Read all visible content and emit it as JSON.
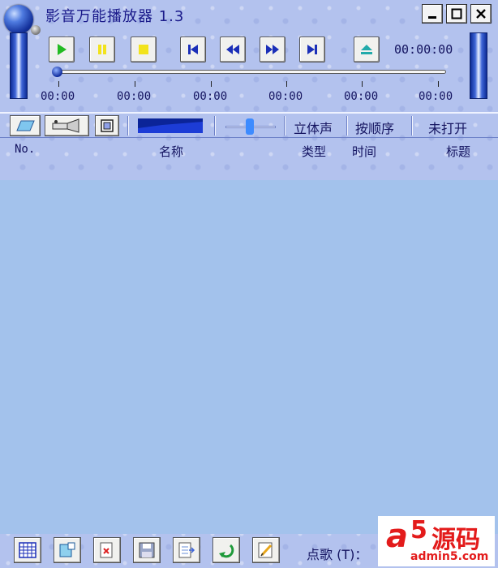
{
  "app": {
    "title": "影音万能播放器 1.3"
  },
  "window_controls": {
    "minimize": "minimize-icon",
    "maximize": "maximize-icon",
    "close": "close-icon"
  },
  "transport": {
    "buttons": [
      "play-icon",
      "pause-icon",
      "stop-icon",
      "previous-track-icon",
      "rewind-icon",
      "fast-forward-icon",
      "next-track-icon",
      "eject-icon"
    ],
    "total_time": "00:00:00"
  },
  "progress": {
    "position_fraction": 0,
    "tick_labels": [
      "00:00",
      "00:00",
      "00:00",
      "00:00",
      "00:00",
      "00:00"
    ]
  },
  "toolbar2": {
    "stereo_label": "立体声",
    "order_label": "按顺序",
    "status_label": "未打开",
    "volume_fraction": 0.48
  },
  "columns": {
    "no": "No.",
    "name": "名称",
    "type": "类型",
    "time": "时间",
    "title": "标题"
  },
  "bottom": {
    "request_label": "点歌 (T)："
  },
  "watermark": {
    "logo_a": "a",
    "logo_5": "5",
    "logo_text": "源码",
    "url": "admin5.com"
  },
  "colors": {
    "title_text": "#1a1a8a",
    "playlist_bg": "#a3c2ec",
    "panel_bg": "#b3c2ee",
    "accent_blue": "#0d2a9c",
    "play_green": "#22bb22",
    "pause_yellow": "#f2e31b",
    "watermark_red": "#e31b1b"
  }
}
